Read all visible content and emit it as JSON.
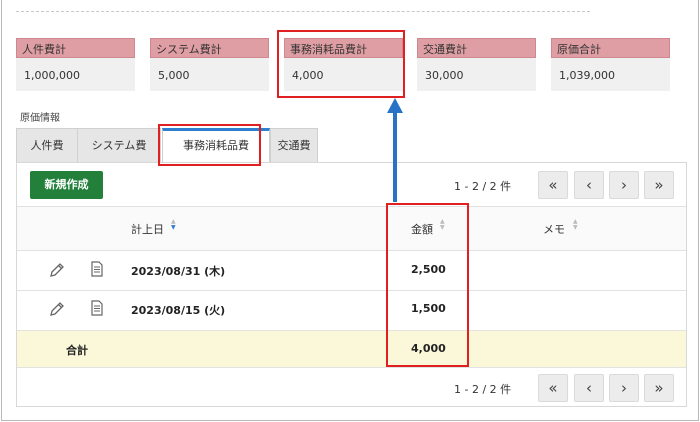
{
  "summary": [
    {
      "label": "人件費計",
      "value": "1,000,000"
    },
    {
      "label": "システム費計",
      "value": "5,000"
    },
    {
      "label": "事務消耗品費計",
      "value": "4,000"
    },
    {
      "label": "交通費計",
      "value": "30,000"
    },
    {
      "label": "原価合計",
      "value": "1,039,000"
    }
  ],
  "section_label": "原価情報",
  "tabs": [
    {
      "label": "人件費"
    },
    {
      "label": "システム費"
    },
    {
      "label": "事務消耗品費"
    },
    {
      "label": "交通費"
    }
  ],
  "active_tab": "事務消耗品費",
  "new_button_label": "新規作成",
  "pager": {
    "text": "1 - 2 / 2 件",
    "first": "«",
    "prev": "‹",
    "next": "›",
    "last": "»"
  },
  "table": {
    "columns": {
      "date": "計上日",
      "amount": "金額",
      "memo": "メモ"
    },
    "rows": [
      {
        "date": "2023/08/31 (木)",
        "amount": "2,500",
        "memo": ""
      },
      {
        "date": "2023/08/15 (火)",
        "amount": "1,500",
        "memo": ""
      }
    ],
    "total_label": "合計",
    "total_amount": "4,000"
  },
  "colors": {
    "summary_header": "#df9ea3",
    "button_green": "#23803a",
    "active_tab_accent": "#2f7fcf",
    "highlight_red": "#e02020",
    "arrow_blue": "#2774c6",
    "total_row_bg": "#fbf8d9"
  },
  "icons": [
    "pencil-icon",
    "document-icon",
    "sort-icon"
  ]
}
